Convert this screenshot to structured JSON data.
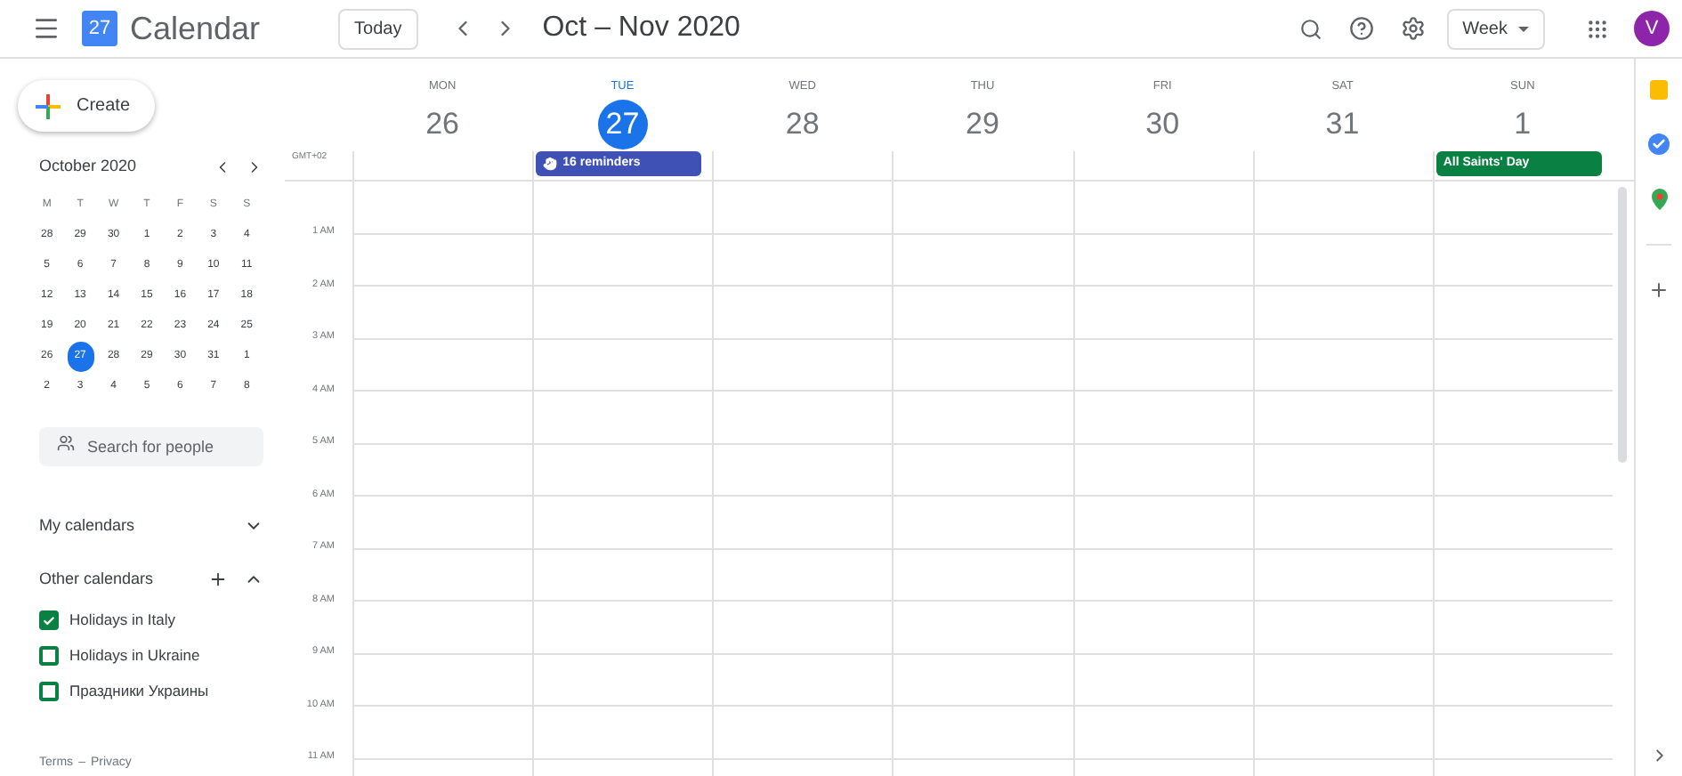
{
  "header": {
    "logo_day": "27",
    "app_name": "Calendar",
    "today_button": "Today",
    "range_title": "Oct – Nov 2020",
    "view_select": "Week",
    "avatar": "V"
  },
  "sidebar": {
    "create_button": "Create",
    "mini_calendar": {
      "title": "October 2020",
      "weekdays": [
        "M",
        "T",
        "W",
        "T",
        "F",
        "S",
        "S"
      ],
      "weeks": [
        [
          {
            "d": "28",
            "selected": false
          },
          {
            "d": "29",
            "selected": false
          },
          {
            "d": "30",
            "selected": false
          },
          {
            "d": "1",
            "selected": false
          },
          {
            "d": "2",
            "selected": false
          },
          {
            "d": "3",
            "selected": false
          },
          {
            "d": "4",
            "selected": false
          }
        ],
        [
          {
            "d": "5",
            "selected": false
          },
          {
            "d": "6",
            "selected": false
          },
          {
            "d": "7",
            "selected": false
          },
          {
            "d": "8",
            "selected": false
          },
          {
            "d": "9",
            "selected": false
          },
          {
            "d": "10",
            "selected": false
          },
          {
            "d": "11",
            "selected": false
          }
        ],
        [
          {
            "d": "12",
            "selected": false
          },
          {
            "d": "13",
            "selected": false
          },
          {
            "d": "14",
            "selected": false
          },
          {
            "d": "15",
            "selected": false
          },
          {
            "d": "16",
            "selected": false
          },
          {
            "d": "17",
            "selected": false
          },
          {
            "d": "18",
            "selected": false
          }
        ],
        [
          {
            "d": "19",
            "selected": false
          },
          {
            "d": "20",
            "selected": false
          },
          {
            "d": "21",
            "selected": false
          },
          {
            "d": "22",
            "selected": false
          },
          {
            "d": "23",
            "selected": false
          },
          {
            "d": "24",
            "selected": false
          },
          {
            "d": "25",
            "selected": false
          }
        ],
        [
          {
            "d": "26",
            "selected": false
          },
          {
            "d": "27",
            "selected": true
          },
          {
            "d": "28",
            "selected": false
          },
          {
            "d": "29",
            "selected": false
          },
          {
            "d": "30",
            "selected": false
          },
          {
            "d": "31",
            "selected": false
          },
          {
            "d": "1",
            "selected": false
          }
        ],
        [
          {
            "d": "2",
            "selected": false
          },
          {
            "d": "3",
            "selected": false
          },
          {
            "d": "4",
            "selected": false
          },
          {
            "d": "5",
            "selected": false
          },
          {
            "d": "6",
            "selected": false
          },
          {
            "d": "7",
            "selected": false
          },
          {
            "d": "8",
            "selected": false
          }
        ]
      ]
    },
    "search": {
      "placeholder": "Search for people"
    },
    "my_calendars": {
      "label": "My calendars",
      "expanded": false
    },
    "other_calendars": {
      "label": "Other calendars",
      "expanded": true,
      "items": [
        {
          "name": "Holidays in Italy",
          "checked": true
        },
        {
          "name": "Holidays in Ukraine",
          "checked": false
        },
        {
          "name": "Праздники Украины",
          "checked": false
        }
      ]
    },
    "footer": [
      "Terms",
      "–",
      "Privacy"
    ]
  },
  "week": {
    "timezone": "GMT+02",
    "days": [
      {
        "weekday": "MON",
        "date": "26",
        "selected": false
      },
      {
        "weekday": "TUE",
        "date": "27",
        "selected": true,
        "event": {
          "title": "16 reminders",
          "kind": "reminder",
          "color": "#3f51b5"
        }
      },
      {
        "weekday": "WED",
        "date": "28",
        "selected": false
      },
      {
        "weekday": "THU",
        "date": "29",
        "selected": false
      },
      {
        "weekday": "FRI",
        "date": "30",
        "selected": false
      },
      {
        "weekday": "SAT",
        "date": "31",
        "selected": false
      },
      {
        "weekday": "SUN",
        "date": "1",
        "selected": false,
        "event": {
          "title": "All Saints' Day",
          "kind": "holiday",
          "color": "#0b8043"
        }
      }
    ],
    "hours": [
      "1 AM",
      "2 AM",
      "3 AM",
      "4 AM",
      "5 AM",
      "6 AM",
      "7 AM",
      "8 AM",
      "9 AM",
      "10 AM",
      "11 AM"
    ]
  }
}
